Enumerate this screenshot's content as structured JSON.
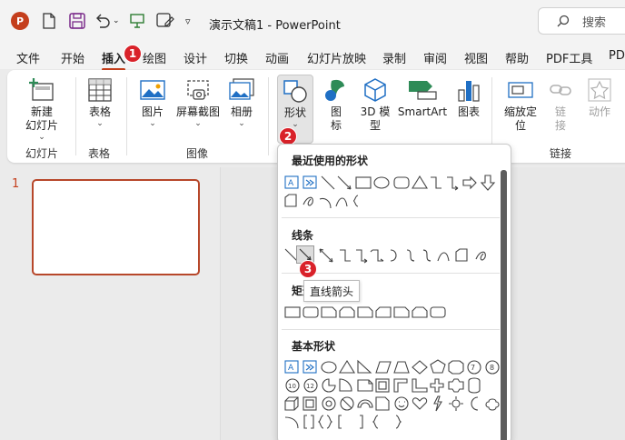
{
  "app": {
    "logo_letter": "P",
    "doc_title": "演示文稿1 - PowerPoint"
  },
  "search": {
    "label": "搜索"
  },
  "tabs": [
    "文件",
    "开始",
    "插入",
    "绘图",
    "设计",
    "切换",
    "动画",
    "幻灯片放映",
    "录制",
    "审阅",
    "视图",
    "帮助",
    "PDF工具",
    "PDF"
  ],
  "active_tab": "插入",
  "ribbon": {
    "new_slide": [
      "新建",
      "幻灯片"
    ],
    "table": "表格",
    "picture": "图片",
    "screenshot": "屏幕截图",
    "album": "相册",
    "shapes": "形状",
    "icons": [
      "图",
      "标"
    ],
    "model3d": [
      "3D 模",
      "型"
    ],
    "smartart": "SmartArt",
    "chart": "图表",
    "zoom": [
      "缩放定",
      "位"
    ],
    "link": [
      "链",
      "接"
    ],
    "action": "动作",
    "groups": {
      "slides": "幻灯片",
      "tables": "表格",
      "images": "图像",
      "links": "链接"
    }
  },
  "slides_panel": {
    "slide_number": "1"
  },
  "shapes_menu": {
    "recent": "最近使用的形状",
    "lines": "线条",
    "rect": "矩形",
    "basic": "基本形状"
  },
  "tooltip": "直线箭头",
  "badges": [
    "1",
    "2",
    "3"
  ],
  "colors": {
    "accent": "#c43e1c",
    "badge": "#d9222a",
    "green": "#2e8b57",
    "blue": "#1f6fc4"
  }
}
